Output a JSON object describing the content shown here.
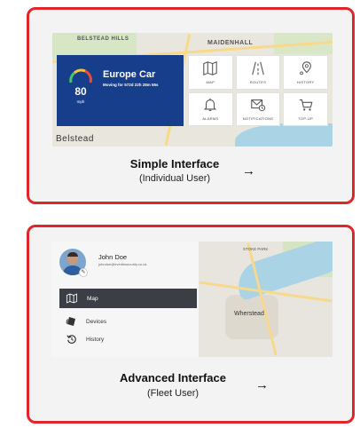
{
  "simple": {
    "title": "Simple Interface",
    "subtitle": "(Individual User)",
    "arrow": "→",
    "map_labels": {
      "belstead_hills": "BELSTEAD HILLS",
      "maidenhall": "MAIDENHALL",
      "belstead": "Belstead"
    },
    "vehicle": {
      "name": "Europe Car",
      "status": "Moving for 572d 22h 28m 55s",
      "speed": "80",
      "unit": "mph"
    },
    "tiles": [
      {
        "label": "MAP",
        "icon": "map-icon"
      },
      {
        "label": "ROUTES",
        "icon": "road-icon"
      },
      {
        "label": "HISTORY",
        "icon": "location-pin-icon"
      },
      {
        "label": "ALARMS",
        "icon": "bell-icon"
      },
      {
        "label": "NOTIFICATIONS",
        "icon": "mail-clock-icon"
      },
      {
        "label": "TOP-UP",
        "icon": "cart-icon"
      }
    ],
    "colors": {
      "panel": "#163e8a",
      "border": "#e0262b"
    }
  },
  "advanced": {
    "title": "Advanced Interface",
    "subtitle": "(Fleet User)",
    "arrow": "→",
    "user": {
      "name": "John Doe",
      "email": "johndoe@everitesecurity.co.uk"
    },
    "nav": {
      "map": "Map",
      "devices": "Devices",
      "history": "History"
    },
    "map_labels": {
      "stoke": "STOKE PARK",
      "wherstead": "Wherstead"
    }
  }
}
